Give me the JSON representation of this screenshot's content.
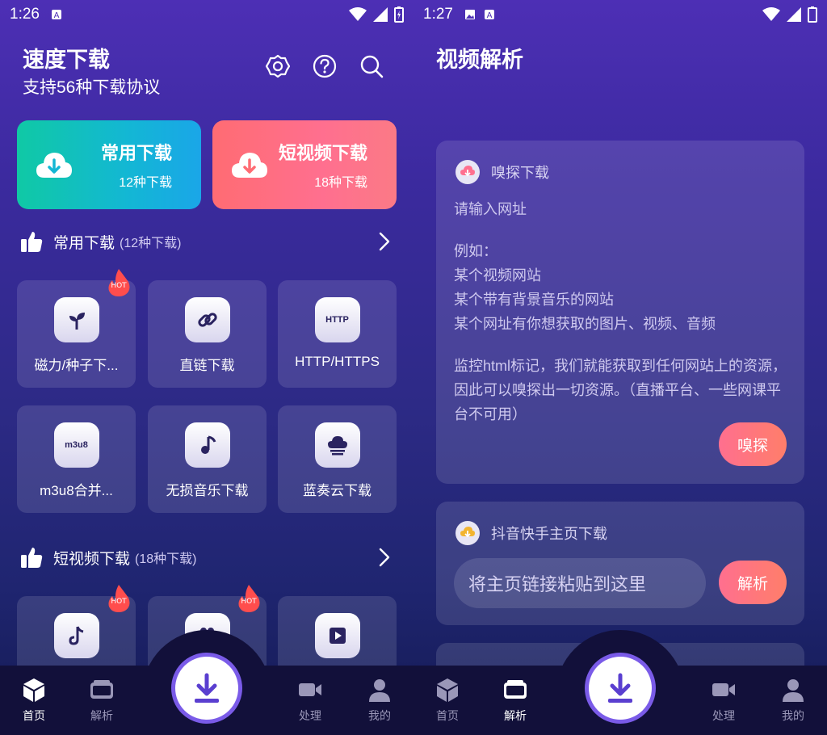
{
  "left": {
    "status": {
      "time": "1:26"
    },
    "header": {
      "title": "速度下载",
      "subtitle": "支持56种下载协议"
    },
    "top_icons": [
      "settings-icon",
      "help-icon",
      "search-icon"
    ],
    "big_cards": [
      {
        "title": "常用下载",
        "sub": "12种下载"
      },
      {
        "title": "短视频下载",
        "sub": "18种下载"
      }
    ],
    "section1": {
      "label": "常用下载",
      "count": "(12种下载)"
    },
    "tiles1": [
      {
        "label": "磁力/种子下...",
        "icon": "sprout-icon",
        "hot": true
      },
      {
        "label": "直链下载",
        "icon": "link-icon",
        "hot": false
      },
      {
        "label": "HTTP/HTTPS",
        "icon": "http-icon",
        "icon_text": "HTTP",
        "hot": false
      },
      {
        "label": "m3u8合并...",
        "icon": "m3u8-icon",
        "icon_text": "m3u8",
        "hot": false
      },
      {
        "label": "无损音乐下载",
        "icon": "music-note-icon",
        "hot": false
      },
      {
        "label": "蓝奏云下载",
        "icon": "cloud-icon",
        "hot": false
      }
    ],
    "section2": {
      "label": "短视频下载",
      "count": "(18种下载)"
    },
    "tiles2": [
      {
        "icon": "tiktok-icon",
        "hot": true
      },
      {
        "icon": "video-camera-icon",
        "hot": true
      },
      {
        "icon": "play-icon",
        "hot": false
      }
    ],
    "hot_text": "HOT"
  },
  "right": {
    "status": {
      "time": "1:27"
    },
    "header": {
      "title": "视频解析"
    },
    "sniff": {
      "title": "嗅探下载",
      "hint_lines": [
        "请输入网址",
        "",
        "例如：",
        "某个视频网站",
        "某个带有背景音乐的网站",
        "某个网址有你想获取的图片、视频、音频",
        "",
        "监控html标记，我们就能获取到任何网站上的资源，因此可以嗅探出一切资源。（直播平台、一些网课平台不可用）"
      ],
      "button": "嗅探"
    },
    "douyin": {
      "title": "抖音快手主页下载",
      "placeholder": "将主页链接粘贴到这里",
      "button": "解析"
    }
  },
  "nav": {
    "home": "首页",
    "parse": "解析",
    "process": "处理",
    "mine": "我的"
  },
  "colors": {
    "accent": "#7a5be8",
    "pink": "#ff6f8f",
    "teal": "#10c9a5"
  }
}
